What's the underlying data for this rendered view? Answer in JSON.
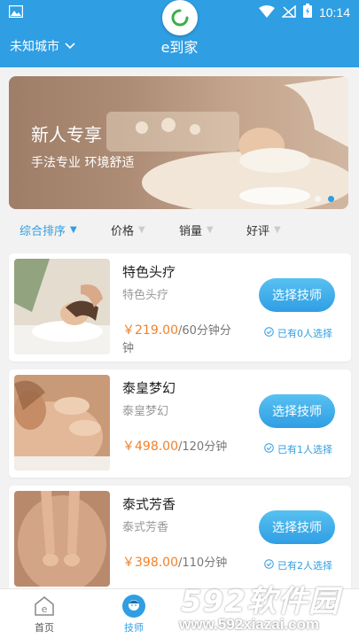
{
  "status": {
    "time": "10:14"
  },
  "header": {
    "city": "未知城市",
    "title": "e到家"
  },
  "banner": {
    "title": "新人专享",
    "subtitle": "手法专业  环境舒适",
    "slide_index": 2,
    "slide_count": 2
  },
  "sort": {
    "items": [
      {
        "label": "综合排序"
      },
      {
        "label": "价格"
      },
      {
        "label": "销量"
      },
      {
        "label": "好评"
      }
    ]
  },
  "services": [
    {
      "name": "特色头疗",
      "desc": "特色头疗",
      "price": "￥219.00",
      "unit": "/60分钟分钟",
      "button": "选择技师",
      "chosen": "已有0人选择"
    },
    {
      "name": "泰皇梦幻",
      "desc": "泰皇梦幻",
      "price": "￥498.00",
      "unit": "/120分钟",
      "button": "选择技师",
      "chosen": "已有1人选择"
    },
    {
      "name": "泰式芳香",
      "desc": "泰式芳香",
      "price": "￥398.00",
      "unit": "/110分钟",
      "button": "选择技师",
      "chosen": "已有2人选择"
    }
  ],
  "tabs": [
    {
      "label": "首页"
    },
    {
      "label": "技师"
    }
  ],
  "watermark": {
    "big": "592软件园",
    "small": "www.592xiazai.com"
  },
  "colors": {
    "primary": "#2f9ee3",
    "price": "#f0822a"
  }
}
